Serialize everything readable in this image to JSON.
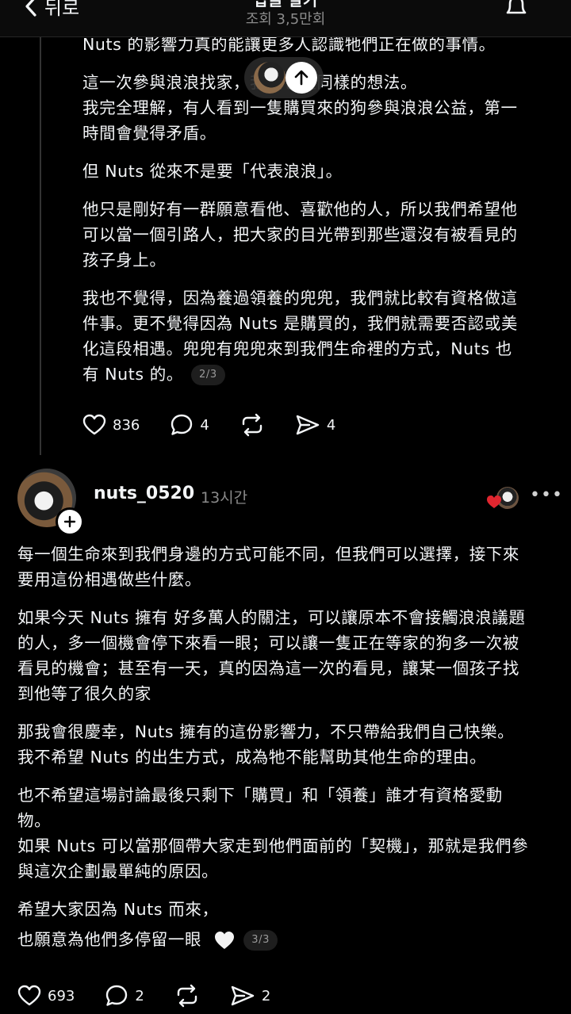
{
  "header": {
    "back_label": "뒤로",
    "title": "답글 달기",
    "views": "조회 3,5만회"
  },
  "post1": {
    "lines": [
      "Nuts 的影響力真的能讓更多人認識牠們正在做的事情。",
      "",
      "這一次參與浪浪找家，我們也是同樣的想法。",
      "我完全理解，有人看到一隻購買來的狗參與浪浪公益，第一",
      "時間會覺得矛盾。",
      "",
      "但 Nuts 從來不是要「代表浪浪」。",
      "",
      "他只是剛好有一群願意看他、喜歡他的人，所以我們希望他",
      "可以當一個引路人，把大家的目光帶到那些還沒有被看見的",
      "孩子身上。",
      "",
      "我也不覺得，因為養過領養的兜兜，我們就比較有資格做這",
      "件事。更不覺得因為 Nuts 是購買的，我們就需要否認或美",
      "化這段相遇。兜兜有兜兜來到我們生命裡的方式，Nuts 也",
      "有 Nuts 的。"
    ],
    "page_badge": "2/3",
    "likes": "836",
    "comments": "4",
    "shares": "4"
  },
  "post2": {
    "username": "nuts_0520",
    "time": "13시간",
    "more": "•••",
    "lines": [
      "每一個生命來到我們身邊的方式可能不同，但我們可以選擇，接下來",
      "要用這份相遇做些什麼。",
      "",
      "如果今天 Nuts 擁有 好多萬人的關注，可以讓原本不會接觸浪浪議題",
      "的人，多一個機會停下來看一眼；可以讓一隻正在等家的狗多一次被",
      "看見的機會；甚至有一天，真的因為這一次的看見，讓某一個孩子找",
      "到他等了很久的家",
      "",
      "那我會很慶幸，Nuts 擁有的這份影響力，不只帶給我們自己快樂。",
      "我不希望 Nuts 的出生方式，成為牠不能幫助其他生命的理由。",
      "",
      "也不希望這場討論最後只剩下「購買」和「領養」誰才有資格愛動",
      "物。",
      "如果 Nuts 可以當那個帶大家走到他們面前的「契機」，那就是我們參",
      "與這次企劃最單純的原因。",
      "",
      "希望大家因為 Nuts 而來，",
      "也願意為他們多停留一眼"
    ],
    "page_badge": "3/3",
    "likes": "693",
    "comments": "2",
    "shares": "2"
  },
  "colors": {
    "background": "#000000",
    "text": "#f3f5f7",
    "muted": "#8a8a8a",
    "like_red": "#e0262f"
  },
  "icons": {
    "back": "chevron-left-icon",
    "bell": "bell-icon",
    "up": "arrow-up-icon",
    "heart": "heart-icon",
    "comment": "comment-icon",
    "repost": "repost-icon",
    "share": "send-icon",
    "white_heart": "white-heart-icon"
  }
}
